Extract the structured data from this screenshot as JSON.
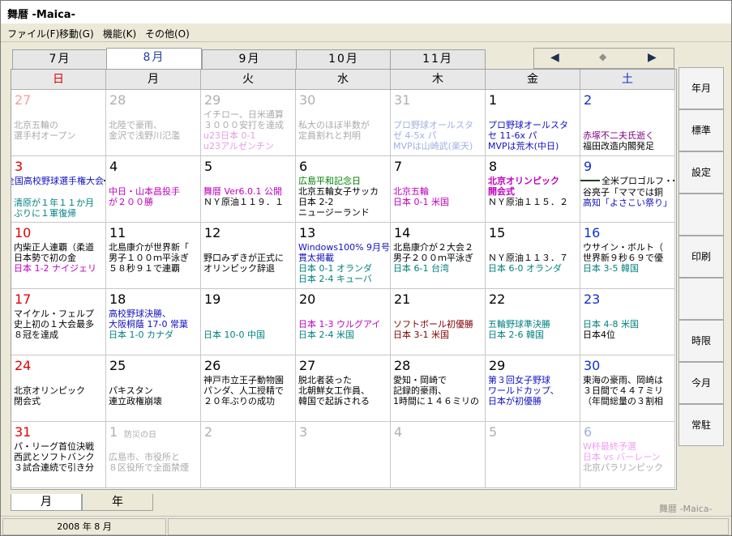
{
  "window": {
    "title": "舞暦 -Maica-"
  },
  "menu": [
    "ファイル(F)",
    "移動(G)",
    "機能(K)",
    "その他(O)"
  ],
  "month_tabs": [
    {
      "label": "7月",
      "selected": false
    },
    {
      "label": "8月",
      "selected": true
    },
    {
      "label": "9月",
      "selected": false
    },
    {
      "label": "10月",
      "selected": false
    },
    {
      "label": "11月",
      "selected": false
    }
  ],
  "nav": {
    "prev": "◀",
    "center": "◆",
    "next": "▶"
  },
  "weekdays": [
    {
      "label": "日",
      "color": "#e00000"
    },
    {
      "label": "月",
      "color": "#000000"
    },
    {
      "label": "火",
      "color": "#000000"
    },
    {
      "label": "水",
      "color": "#000000"
    },
    {
      "label": "木",
      "color": "#000000"
    },
    {
      "label": "金",
      "color": "#000000"
    },
    {
      "label": "土",
      "color": "#1030d0"
    }
  ],
  "calendar": {
    "weeks": [
      [
        {
          "day": "27",
          "dim": true,
          "color": "#f0a0a0",
          "events": [
            {
              "text": "",
              "color": "#aaaaaa"
            },
            {
              "text": "北京五輪の",
              "color": "#aaaaaa"
            },
            {
              "text": "選手村オープン",
              "color": "#aaaaaa"
            }
          ]
        },
        {
          "day": "28",
          "dim": true,
          "events": [
            {
              "text": "",
              "color": "#aaaaaa"
            },
            {
              "text": "北陸で豪雨、",
              "color": "#aaaaaa"
            },
            {
              "text": "金沢で浅野川氾濫",
              "color": "#aaaaaa"
            }
          ]
        },
        {
          "day": "29",
          "dim": true,
          "events": [
            {
              "text": "イチロー、日米通算",
              "color": "#aaaaaa"
            },
            {
              "text": "３０００安打を達成",
              "color": "#aaaaaa"
            },
            {
              "text": "u23日本 0-1",
              "color": "#e0a0e0"
            },
            {
              "text": " u23アルゼンチン",
              "color": "#e0a0e0"
            }
          ]
        },
        {
          "day": "30",
          "dim": true,
          "events": [
            {
              "text": "",
              "color": "#aaaaaa"
            },
            {
              "text": "私大のほぼ半数が",
              "color": "#aaaaaa"
            },
            {
              "text": "定員割れと判明",
              "color": "#aaaaaa"
            }
          ]
        },
        {
          "day": "31",
          "dim": true,
          "events": [
            {
              "text": "",
              "color": "#aaaaaa"
            },
            {
              "text": "プロ野球オールスタ",
              "color": "#a0b0e0"
            },
            {
              "text": "ゼ 4-5x パ",
              "color": "#a0b0e0"
            },
            {
              "text": "MVPは山崎武(楽天)",
              "color": "#a0b0e0"
            }
          ]
        },
        {
          "day": "1",
          "color": "#000000",
          "events": [
            {
              "text": "",
              "color": "#000"
            },
            {
              "text": "プロ野球オールスタ",
              "color": "#1010c0"
            },
            {
              "text": "セ 11-6x パ",
              "color": "#1010c0"
            },
            {
              "text": "MVPは荒木(中日)",
              "color": "#1010c0"
            }
          ]
        },
        {
          "day": "2",
          "color": "#1030d0",
          "events": [
            {
              "text": "",
              "color": "#000"
            },
            {
              "text": "",
              "color": "#000"
            },
            {
              "text": "赤塚不二夫氏逝く",
              "color": "#800080"
            },
            {
              "text": "福田改造内閣発足",
              "color": "#000000"
            }
          ]
        }
      ],
      [
        {
          "day": "3",
          "color": "#e00000",
          "banner": "全国高校野球選手権大会",
          "bannerColor": "#1010c0",
          "events": [
            {
              "text": "",
              "color": "#000"
            },
            {
              "text": "清原が１年１１か月",
              "color": "#008080"
            },
            {
              "text": "ぶりに１軍復帰",
              "color": "#008080"
            }
          ]
        },
        {
          "day": "4",
          "color": "#000000",
          "events": [
            {
              "text": "",
              "color": "#000"
            },
            {
              "text": "中日・山本昌投手",
              "color": "#c000c0"
            },
            {
              "text": "が２００勝",
              "color": "#c000c0"
            }
          ]
        },
        {
          "day": "5",
          "color": "#000000",
          "events": [
            {
              "text": "",
              "color": "#000"
            },
            {
              "text": "舞暦 Ver6.0.1 公開",
              "color": "#c000c0"
            },
            {
              "text": "ＮＹ原油１１９．１",
              "color": "#000000"
            }
          ]
        },
        {
          "day": "6",
          "color": "#000000",
          "events": [
            {
              "text": "広島平和記念日",
              "color": "#008000"
            },
            {
              "text": "北京五輪女子サッカ",
              "color": "#000000"
            },
            {
              "text": "日本 2-2",
              "color": "#000000"
            },
            {
              "text": "   ニュージーランド",
              "color": "#000000"
            }
          ]
        },
        {
          "day": "7",
          "color": "#000000",
          "events": [
            {
              "text": "",
              "color": "#000"
            },
            {
              "text": "北京五輪",
              "color": "#c000c0"
            },
            {
              "text": "日本 0-1 米国",
              "color": "#c000c0"
            }
          ]
        },
        {
          "day": "8",
          "color": "#000000",
          "events": [
            {
              "text": "北京オリンピック",
              "color": "#c000c0",
              "bold": true
            },
            {
              "text": "開会式",
              "color": "#c000c0",
              "bold": true
            },
            {
              "text": "ＮＹ原油１１５．２",
              "color": "#000000"
            }
          ]
        },
        {
          "day": "9",
          "color": "#1030d0",
          "banner": "全米プロゴルフ・",
          "bannerColor": "#000000",
          "events": [
            {
              "text": "谷亮子「ママでは銅",
              "color": "#000000"
            },
            {
              "text": "高知「よさこい祭り」",
              "color": "#1010c0"
            }
          ]
        }
      ],
      [
        {
          "day": "10",
          "color": "#e00000",
          "events": [
            {
              "text": "内柴正人連覇（柔道",
              "color": "#000000"
            },
            {
              "text": "日本勢で初の金",
              "color": "#000000"
            },
            {
              "text": "日本 1-2 ナイジェリ",
              "color": "#c000c0"
            }
          ]
        },
        {
          "day": "11",
          "color": "#000000",
          "events": [
            {
              "text": "北島康介が世界新「",
              "color": "#000000"
            },
            {
              "text": "男子１００ｍ平泳ぎ",
              "color": "#000000"
            },
            {
              "text": "５８秒９１で連覇",
              "color": "#000000"
            }
          ]
        },
        {
          "day": "12",
          "color": "#000000",
          "events": [
            {
              "text": "",
              "color": "#000"
            },
            {
              "text": "野口みずきが正式に",
              "color": "#000000"
            },
            {
              "text": "オリンピック辞退",
              "color": "#000000"
            }
          ]
        },
        {
          "day": "13",
          "color": "#000000",
          "events": [
            {
              "text": "Windows100% 9月号」",
              "color": "#1010c0"
            },
            {
              "text": "貫太掲載",
              "color": "#1010c0"
            },
            {
              "text": "日本 0-1 オランダ",
              "color": "#008080"
            },
            {
              "text": "日本 2-4 キューバ",
              "color": "#008080"
            }
          ]
        },
        {
          "day": "14",
          "color": "#000000",
          "events": [
            {
              "text": "北島康介が２大会２",
              "color": "#000000"
            },
            {
              "text": "男子２００ｍ平泳ぎ",
              "color": "#000000"
            },
            {
              "text": "日本 6-1 台湾",
              "color": "#008080"
            }
          ]
        },
        {
          "day": "15",
          "color": "#000000",
          "events": [
            {
              "text": "",
              "color": "#000"
            },
            {
              "text": "ＮＹ原油１１３．７",
              "color": "#000000"
            },
            {
              "text": "日本 6-0 オランダ",
              "color": "#008080"
            }
          ]
        },
        {
          "day": "16",
          "color": "#1030d0",
          "events": [
            {
              "text": "ウサイン・ボルト（",
              "color": "#000000"
            },
            {
              "text": "世界新９秒６９で優",
              "color": "#000000"
            },
            {
              "text": "日本 3-5 韓国",
              "color": "#008080"
            }
          ]
        }
      ],
      [
        {
          "day": "17",
          "color": "#e00000",
          "events": [
            {
              "text": "マイケル・フェルプ",
              "color": "#000000"
            },
            {
              "text": "史上初の１大会最多",
              "color": "#000000"
            },
            {
              "text": "８冠を達成",
              "color": "#000000"
            }
          ]
        },
        {
          "day": "18",
          "color": "#000000",
          "events": [
            {
              "text": "高校野球決勝、",
              "color": "#1010c0"
            },
            {
              "text": "大阪桐蔭 17-0 常葉",
              "color": "#1010c0"
            },
            {
              "text": "日本 1-0 カナダ",
              "color": "#008080"
            }
          ]
        },
        {
          "day": "19",
          "color": "#000000",
          "events": [
            {
              "text": "",
              "color": "#000"
            },
            {
              "text": "",
              "color": "#000"
            },
            {
              "text": "日本 10-0 中国",
              "color": "#008080"
            }
          ]
        },
        {
          "day": "20",
          "color": "#000000",
          "events": [
            {
              "text": "",
              "color": "#000"
            },
            {
              "text": "日本 1-3 ウルグアイ",
              "color": "#c000c0"
            },
            {
              "text": "日本 2-4 米国",
              "color": "#008080"
            }
          ]
        },
        {
          "day": "21",
          "color": "#000000",
          "events": [
            {
              "text": "",
              "color": "#000"
            },
            {
              "text": "ソフトボール初優勝",
              "color": "#800000"
            },
            {
              "text": "日本 3-1 米国",
              "color": "#800000"
            }
          ]
        },
        {
          "day": "22",
          "color": "#000000",
          "events": [
            {
              "text": "",
              "color": "#000"
            },
            {
              "text": "五輪野球準決勝",
              "color": "#008080"
            },
            {
              "text": "日本 2-6 韓国",
              "color": "#008080"
            }
          ]
        },
        {
          "day": "23",
          "color": "#1030d0",
          "events": [
            {
              "text": "",
              "color": "#000"
            },
            {
              "text": "日本 4-8 米国",
              "color": "#008080"
            },
            {
              "text": "日本4位",
              "color": "#000000"
            }
          ]
        }
      ],
      [
        {
          "day": "24",
          "color": "#e00000",
          "events": [
            {
              "text": "",
              "color": "#000"
            },
            {
              "text": "北京オリンピック",
              "color": "#000000"
            },
            {
              "text": "閉会式",
              "color": "#000000"
            }
          ]
        },
        {
          "day": "25",
          "color": "#000000",
          "events": [
            {
              "text": "",
              "color": "#000"
            },
            {
              "text": "パキスタン",
              "color": "#000000"
            },
            {
              "text": "連立政権崩壊",
              "color": "#000000"
            }
          ]
        },
        {
          "day": "26",
          "color": "#000000",
          "events": [
            {
              "text": "神戸市立王子動物園",
              "color": "#000000"
            },
            {
              "text": "パンダ、人工授精で",
              "color": "#000000"
            },
            {
              "text": "２０年ぶりの成功",
              "color": "#000000"
            }
          ]
        },
        {
          "day": "27",
          "color": "#000000",
          "events": [
            {
              "text": "脱北者装った",
              "color": "#000000"
            },
            {
              "text": "北朝鮮女工作員、",
              "color": "#000000"
            },
            {
              "text": "韓国で起訴される",
              "color": "#000000"
            }
          ]
        },
        {
          "day": "28",
          "color": "#000000",
          "events": [
            {
              "text": "愛知・岡崎で",
              "color": "#000000"
            },
            {
              "text": "記録的豪雨、",
              "color": "#000000"
            },
            {
              "text": "1時間に１４６ミリの",
              "color": "#000000"
            }
          ]
        },
        {
          "day": "29",
          "color": "#000000",
          "events": [
            {
              "text": "第３回女子野球",
              "color": "#1010c0"
            },
            {
              "text": "ワールドカップ、",
              "color": "#1010c0"
            },
            {
              "text": "日本が初優勝",
              "color": "#1010c0"
            }
          ]
        },
        {
          "day": "30",
          "color": "#1030d0",
          "events": [
            {
              "text": "東海の豪雨、岡崎は",
              "color": "#000000"
            },
            {
              "text": "３日間で４４７ミリ",
              "color": "#000000"
            },
            {
              "text": "（年間総量の３割相",
              "color": "#000000"
            }
          ]
        }
      ],
      [
        {
          "day": "31",
          "color": "#e00000",
          "events": [
            {
              "text": "パ・リーグ首位決戦",
              "color": "#000000"
            },
            {
              "text": "西武とソフトバンク",
              "color": "#000000"
            },
            {
              "text": "３試合連続で引き分",
              "color": "#000000"
            }
          ]
        },
        {
          "day": "1",
          "dim": true,
          "note": "防災の日",
          "events": [
            {
              "text": "",
              "color": "#aaa"
            },
            {
              "text": "広島市、市役所と",
              "color": "#aaaaaa"
            },
            {
              "text": "８区役所で全面禁煙",
              "color": "#aaaaaa"
            }
          ]
        },
        {
          "day": "2",
          "dim": true,
          "events": []
        },
        {
          "day": "3",
          "dim": true,
          "events": []
        },
        {
          "day": "4",
          "dim": true,
          "events": []
        },
        {
          "day": "5",
          "dim": true,
          "events": []
        },
        {
          "day": "6",
          "dim": true,
          "color": "#a0b0e0",
          "events": [
            {
              "text": "W杯最終予選",
              "color": "#f0a0f0"
            },
            {
              "text": "日本 vs バーレーン",
              "color": "#f0a0f0"
            },
            {
              "text": "北京パラリンピック",
              "color": "#aaaaaa"
            }
          ]
        }
      ]
    ]
  },
  "side_buttons": [
    "年月",
    "標準",
    "設定",
    "",
    "印刷",
    "",
    "時限",
    "今月",
    "常駐"
  ],
  "bottom_tabs": [
    {
      "label": "月",
      "selected": true
    },
    {
      "label": "年",
      "selected": false
    }
  ],
  "watermark": "舞暦 -Maica-",
  "status": {
    "date": "2008 年 8 月"
  }
}
